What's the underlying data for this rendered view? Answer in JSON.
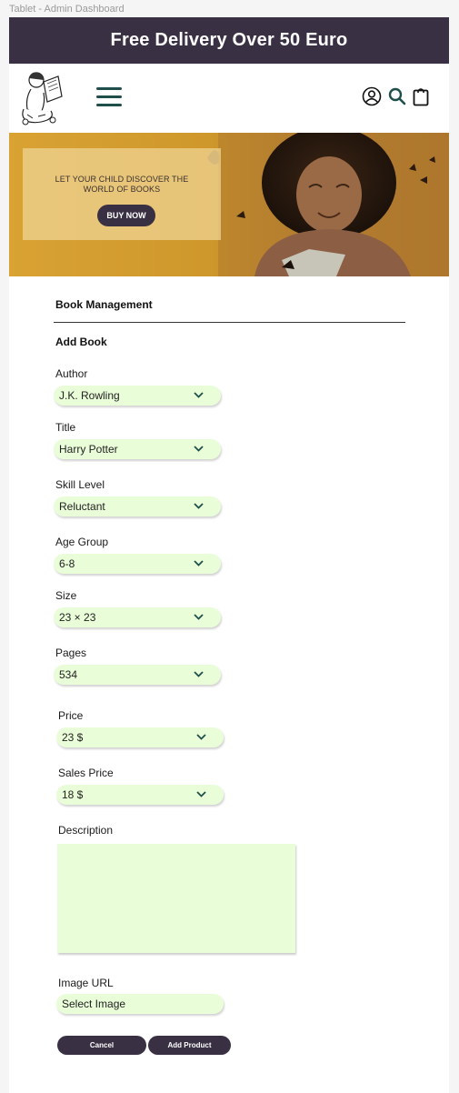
{
  "frame": {
    "label": "Tablet - Admin Dashboard"
  },
  "promo": {
    "text": "Free Delivery Over 50 Euro"
  },
  "header": {
    "logo_icon": "child-reading-book-logo",
    "menu_icon": "hamburger-menu-icon",
    "account_icon": "user-circle-icon",
    "search_icon": "search-icon",
    "cart_icon": "shopping-bag-icon"
  },
  "hero": {
    "text": "LET YOUR CHILD DISCOVER THE WORLD OF BOOKS",
    "button": "BUY NOW"
  },
  "page": {
    "section_title": "Book Management",
    "form_title": "Add Book"
  },
  "form": {
    "author": {
      "label": "Author",
      "value": "J.K. Rowling"
    },
    "title": {
      "label": "Title",
      "value": "Harry Potter"
    },
    "skill_level": {
      "label": "Skill Level",
      "value": "Reluctant"
    },
    "age_group": {
      "label": "Age Group",
      "value": "6-8"
    },
    "size": {
      "label": "Size",
      "value": "23 × 23"
    },
    "pages": {
      "label": "Pages",
      "value": "534"
    },
    "price": {
      "label": "Price",
      "value": "23 $"
    },
    "sales_price": {
      "label": "Sales Price",
      "value": "18 $"
    },
    "description": {
      "label": "Description",
      "value": ""
    },
    "image_url": {
      "label": "Image URL",
      "value": "Select Image"
    }
  },
  "actions": {
    "cancel": "Cancel",
    "add": "Add Product"
  },
  "colors": {
    "brand_dark": "#3a3043",
    "field_bg": "#eafdd9",
    "icon_teal": "#1f4f4a",
    "hero_gold": "#d9a233"
  }
}
